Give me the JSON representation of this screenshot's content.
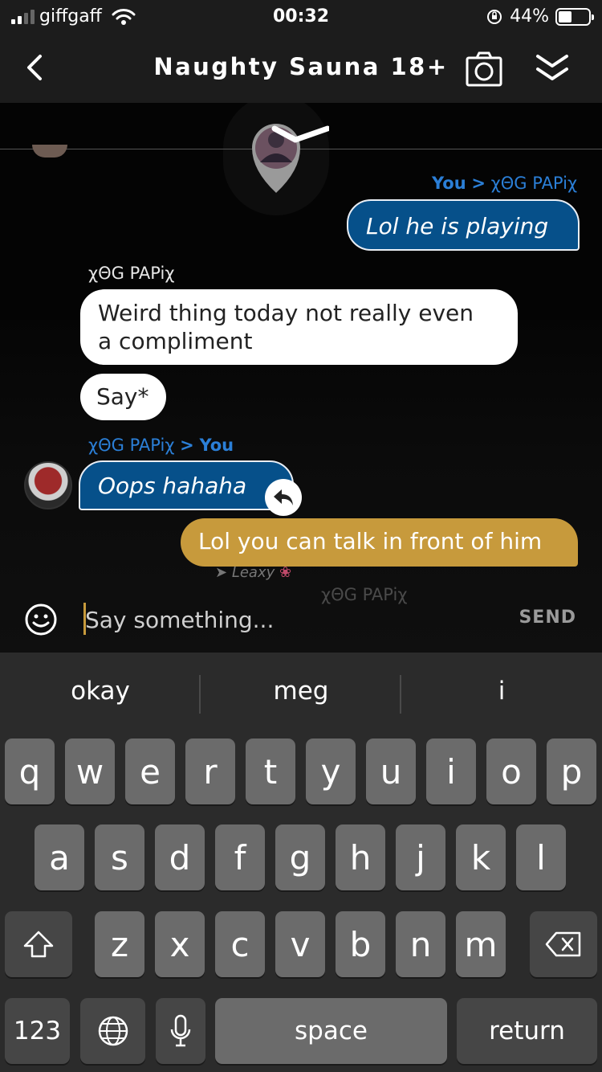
{
  "status_bar": {
    "carrier": "giffgaff",
    "time": "00:32",
    "battery": "44%",
    "battery_level": 0.44
  },
  "header": {
    "title": "Naughty Sauna 18+",
    "back_icon": "chevron-left-icon",
    "camera_icon": "camera-icon",
    "collapse_icon": "double-chevron-down-icon"
  },
  "messages": {
    "m1": {
      "from": "You",
      "to": "χΘG PAPiχ",
      "separator": ">",
      "text": "Lol he is playing"
    },
    "m2": {
      "from": "χΘG PAPiχ",
      "text_1": "Weird thing today not really even",
      "text_2": "a compliment"
    },
    "m3": {
      "text": "Say*"
    },
    "m4": {
      "from": "χΘG PAPiχ",
      "to": "You",
      "separator": ">",
      "text": "Oops  hahaha"
    },
    "m5": {
      "text": "Lol you can talk in front of him"
    }
  },
  "emote": {
    "name_1": "Leaxy",
    "name_2": "χΘG PAPiχ"
  },
  "input": {
    "placeholder": "Say something...",
    "send_label": "SEND"
  },
  "keyboard": {
    "suggestions": [
      "okay",
      "meg",
      "i"
    ],
    "row1": [
      "q",
      "w",
      "e",
      "r",
      "t",
      "y",
      "u",
      "i",
      "o",
      "p"
    ],
    "row2": [
      "a",
      "s",
      "d",
      "f",
      "g",
      "h",
      "j",
      "k",
      "l"
    ],
    "row3": [
      "z",
      "x",
      "c",
      "v",
      "b",
      "n",
      "m"
    ],
    "numbers_label": "123",
    "space_label": "space",
    "return_label": "return"
  },
  "colors": {
    "blue_bubble": "#06508a",
    "gold_bubble": "#c79a3c",
    "label_blue": "#2b7fd7"
  }
}
